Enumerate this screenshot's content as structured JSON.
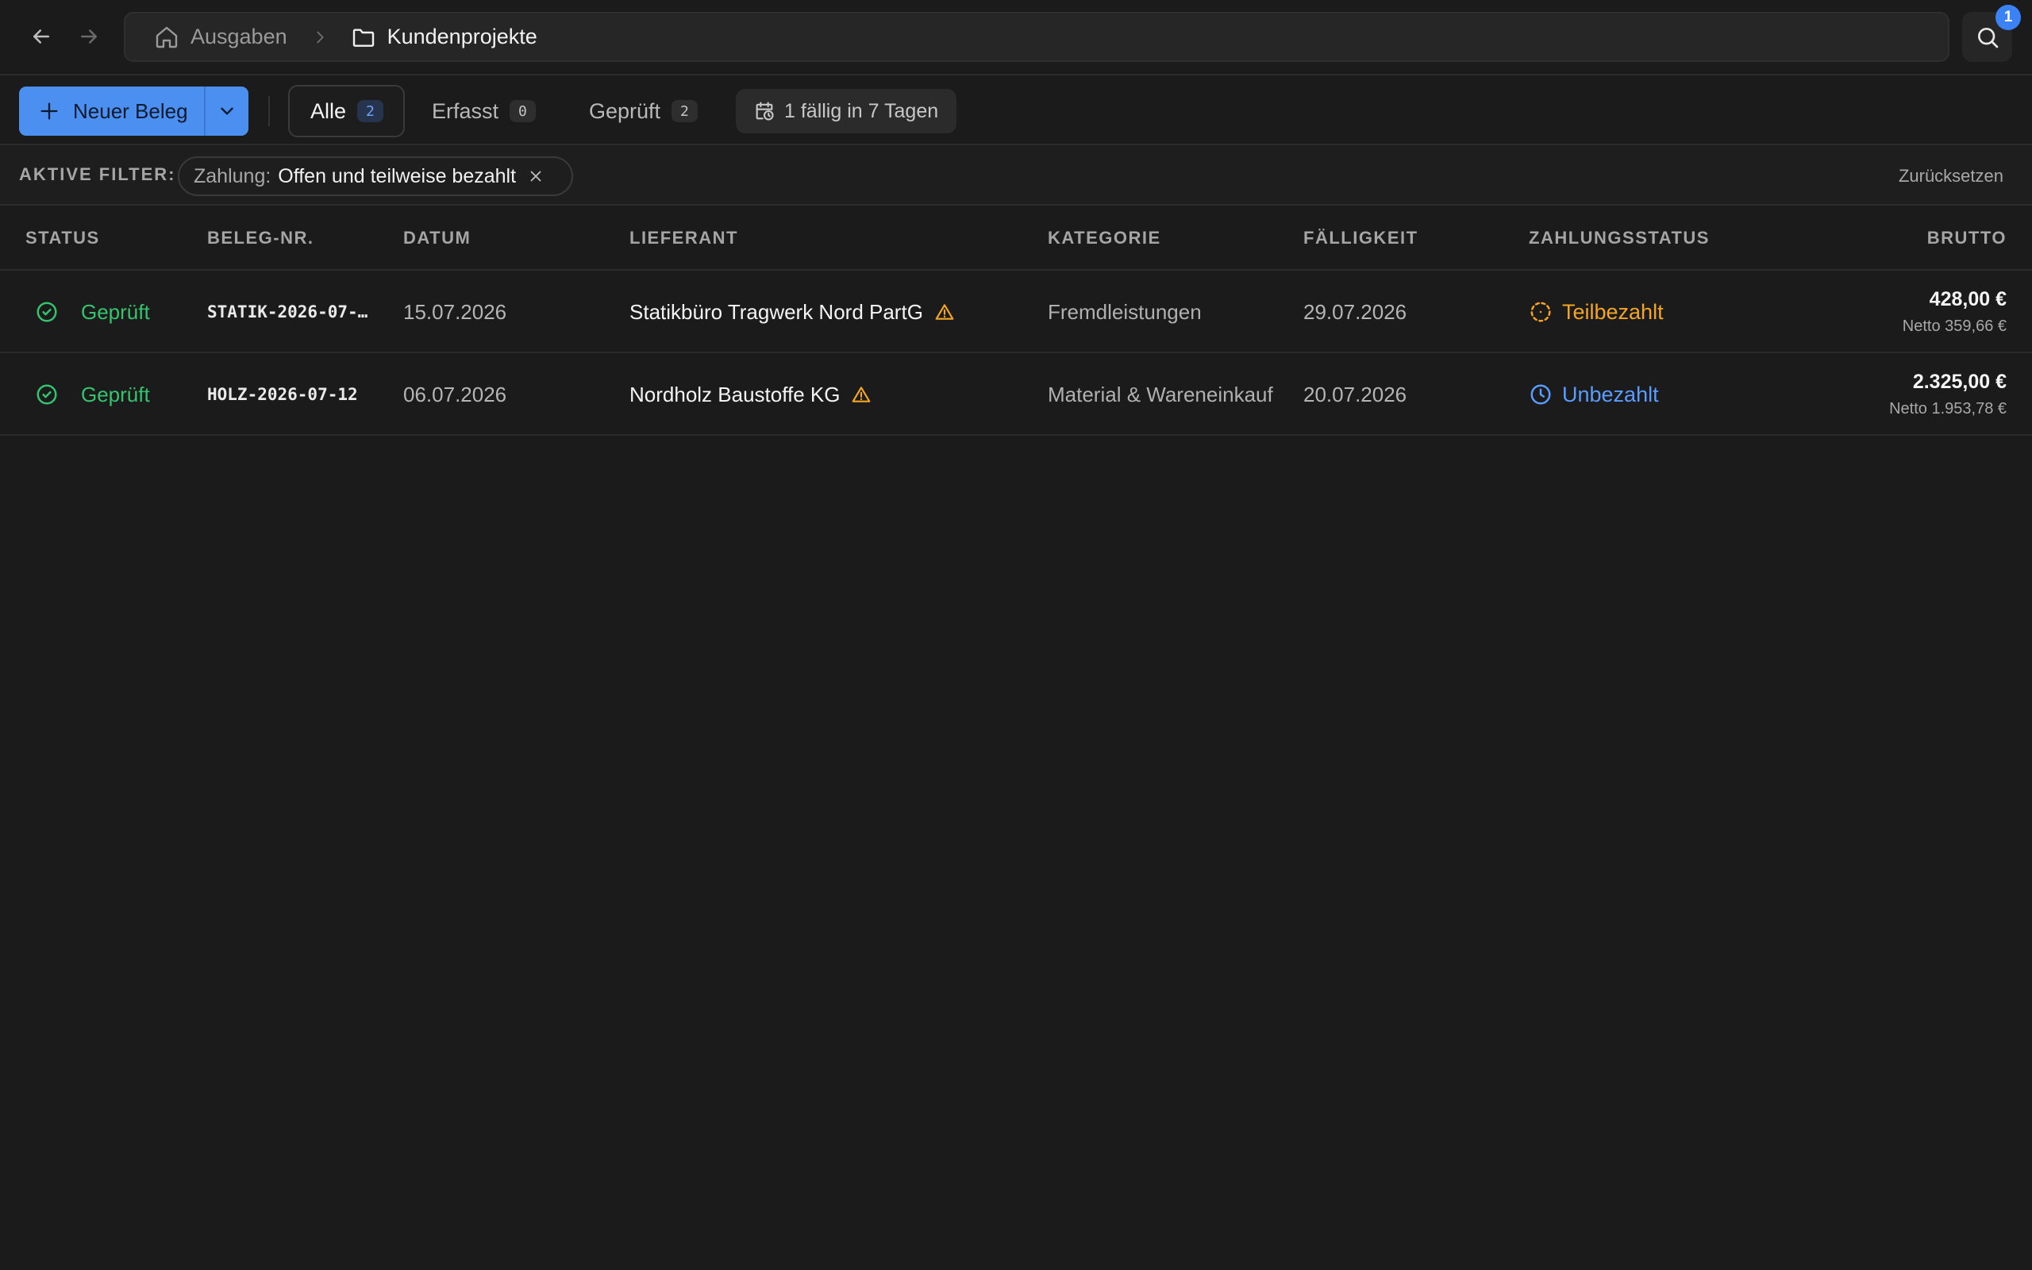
{
  "breadcrumb": {
    "home": "Ausgaben",
    "current": "Kundenprojekte"
  },
  "search": {
    "badge": "1"
  },
  "toolbar": {
    "new_label": "Neuer Beleg",
    "tabs": [
      {
        "label": "Alle",
        "count": "2"
      },
      {
        "label": "Erfasst",
        "count": "0"
      },
      {
        "label": "Geprüft",
        "count": "2"
      }
    ],
    "due_chip": "1 fällig in 7 Tagen"
  },
  "filters": {
    "label": "AKTIVE FILTER:",
    "chip_key": "Zahlung:",
    "chip_value": "Offen und teilweise bezahlt",
    "reset": "Zurücksetzen"
  },
  "table": {
    "headers": {
      "status": "STATUS",
      "beleg": "BELEG-NR.",
      "datum": "DATUM",
      "lieferant": "LIEFERANT",
      "kategorie": "KATEGORIE",
      "faelligkeit": "FÄLLIGKEIT",
      "zahlungsstatus": "ZAHLUNGSSTATUS",
      "brutto": "BRUTTO"
    },
    "rows": [
      {
        "status": "Geprüft",
        "beleg": "STATIK-2026-07-…",
        "datum": "15.07.2026",
        "lieferant": "Statikbüro Tragwerk Nord PartG",
        "kategorie": "Fremdleistungen",
        "faelligkeit": "29.07.2026",
        "zahlungsstatus": "Teilbezahlt",
        "brutto": "428,00 €",
        "netto": "Netto 359,66 €"
      },
      {
        "status": "Geprüft",
        "beleg": "HOLZ-2026-07-12",
        "datum": "06.07.2026",
        "lieferant": "Nordholz Baustoffe KG",
        "kategorie": "Material & Wareneinkauf",
        "faelligkeit": "20.07.2026",
        "zahlungsstatus": "Unbezahlt",
        "brutto": "2.325,00 €",
        "netto": "Netto 1.953,78 €"
      }
    ]
  },
  "colors": {
    "accent": "#4b8ff0",
    "status_ok": "#34c46e",
    "partial": "#f5a524",
    "unpaid": "#5a9cff",
    "warning": "#f5a524"
  },
  "icons": [
    "arrow-left-icon",
    "arrow-right-icon",
    "home-icon",
    "chevron-right-icon",
    "folder-icon",
    "search-icon",
    "plus-icon",
    "chevron-down-icon",
    "calendar-clock-icon",
    "close-icon",
    "check-circle-icon",
    "warning-triangle-icon",
    "dashed-circle-icon",
    "clock-icon"
  ]
}
